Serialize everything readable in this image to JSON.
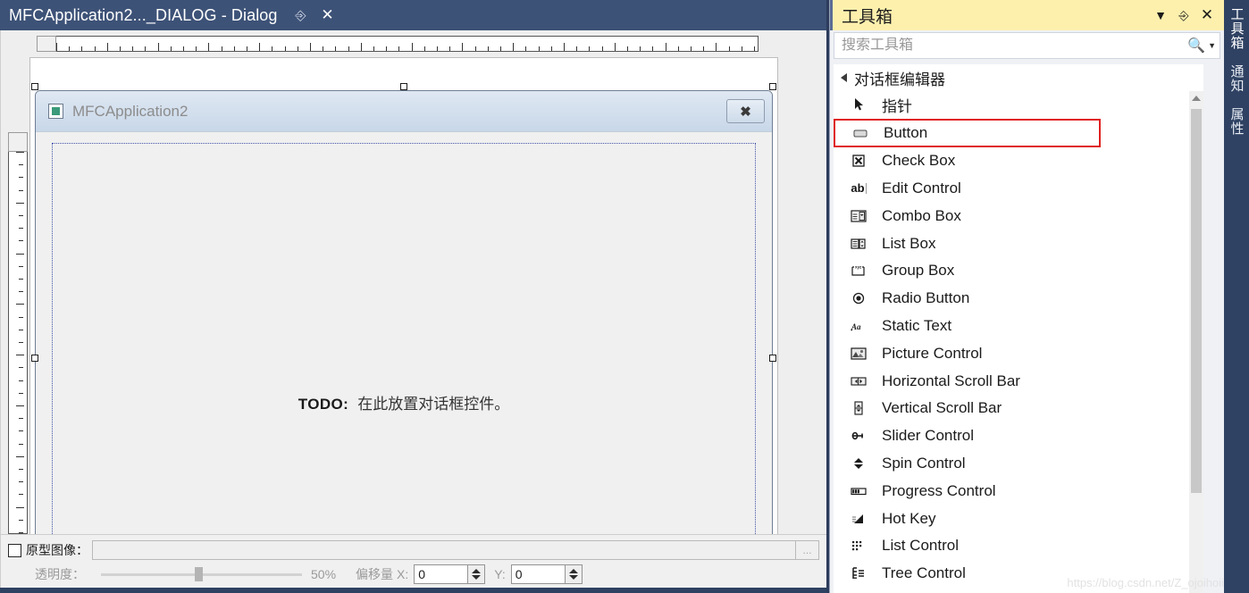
{
  "document_window": {
    "tab_title": "MFCApplication2..._DIALOG - Dialog",
    "pin_icon": "pin-icon",
    "close_icon": "close-icon"
  },
  "dialog_preview": {
    "app_icon": "app-icon",
    "title": "MFCApplication2",
    "close_label": "✖",
    "todo_prefix": "TODO:",
    "todo_text": "在此放置对话框控件。"
  },
  "bottom_bar": {
    "prototype_checkbox_label": "原型图像：",
    "prototype_path_value": "",
    "browse_label": "...",
    "transparency_label": "透明度：",
    "transparency_value": "50%",
    "offset_label": "偏移量",
    "offset_x_label": "X:",
    "offset_x_value": "0",
    "offset_y_label": "Y:",
    "offset_y_value": "0"
  },
  "toolbox": {
    "title": "工具箱",
    "dropdown_icon": "chevron-down-icon",
    "pin_icon": "pin-icon",
    "close_icon": "close-icon",
    "search_placeholder": "搜索工具箱",
    "search_value": "",
    "search_icon": "search-icon",
    "search_caret_icon": "chevron-down-icon",
    "group_label": "对话框编辑器",
    "selection_color": "#e02020",
    "header_color": "#fdf0ad",
    "items": [
      {
        "label": "指针",
        "icon": "pointer-icon",
        "selected": false
      },
      {
        "label": "Button",
        "icon": "button-icon",
        "selected": true
      },
      {
        "label": "Check Box",
        "icon": "checkbox-icon",
        "selected": false
      },
      {
        "label": "Edit Control",
        "icon": "edit-control-icon",
        "selected": false
      },
      {
        "label": "Combo Box",
        "icon": "combo-box-icon",
        "selected": false
      },
      {
        "label": "List Box",
        "icon": "list-box-icon",
        "selected": false
      },
      {
        "label": "Group Box",
        "icon": "group-box-icon",
        "selected": false
      },
      {
        "label": "Radio Button",
        "icon": "radio-button-icon",
        "selected": false
      },
      {
        "label": "Static Text",
        "icon": "static-text-icon",
        "selected": false
      },
      {
        "label": "Picture Control",
        "icon": "picture-control-icon",
        "selected": false
      },
      {
        "label": "Horizontal Scroll Bar",
        "icon": "horizontal-scrollbar-icon",
        "selected": false
      },
      {
        "label": "Vertical Scroll Bar",
        "icon": "vertical-scrollbar-icon",
        "selected": false
      },
      {
        "label": "Slider Control",
        "icon": "slider-control-icon",
        "selected": false
      },
      {
        "label": "Spin Control",
        "icon": "spin-control-icon",
        "selected": false
      },
      {
        "label": "Progress Control",
        "icon": "progress-control-icon",
        "selected": false
      },
      {
        "label": "Hot Key",
        "icon": "hot-key-icon",
        "selected": false
      },
      {
        "label": "List Control",
        "icon": "list-control-icon",
        "selected": false
      },
      {
        "label": "Tree Control",
        "icon": "tree-control-icon",
        "selected": false
      }
    ]
  },
  "vertical_tabs": [
    {
      "label": "工具箱",
      "active": true
    },
    {
      "label": "通知",
      "active": false
    },
    {
      "label": "属性",
      "active": false
    }
  ],
  "watermark": "https://blog.csdn.net/Z_ojoihoii"
}
